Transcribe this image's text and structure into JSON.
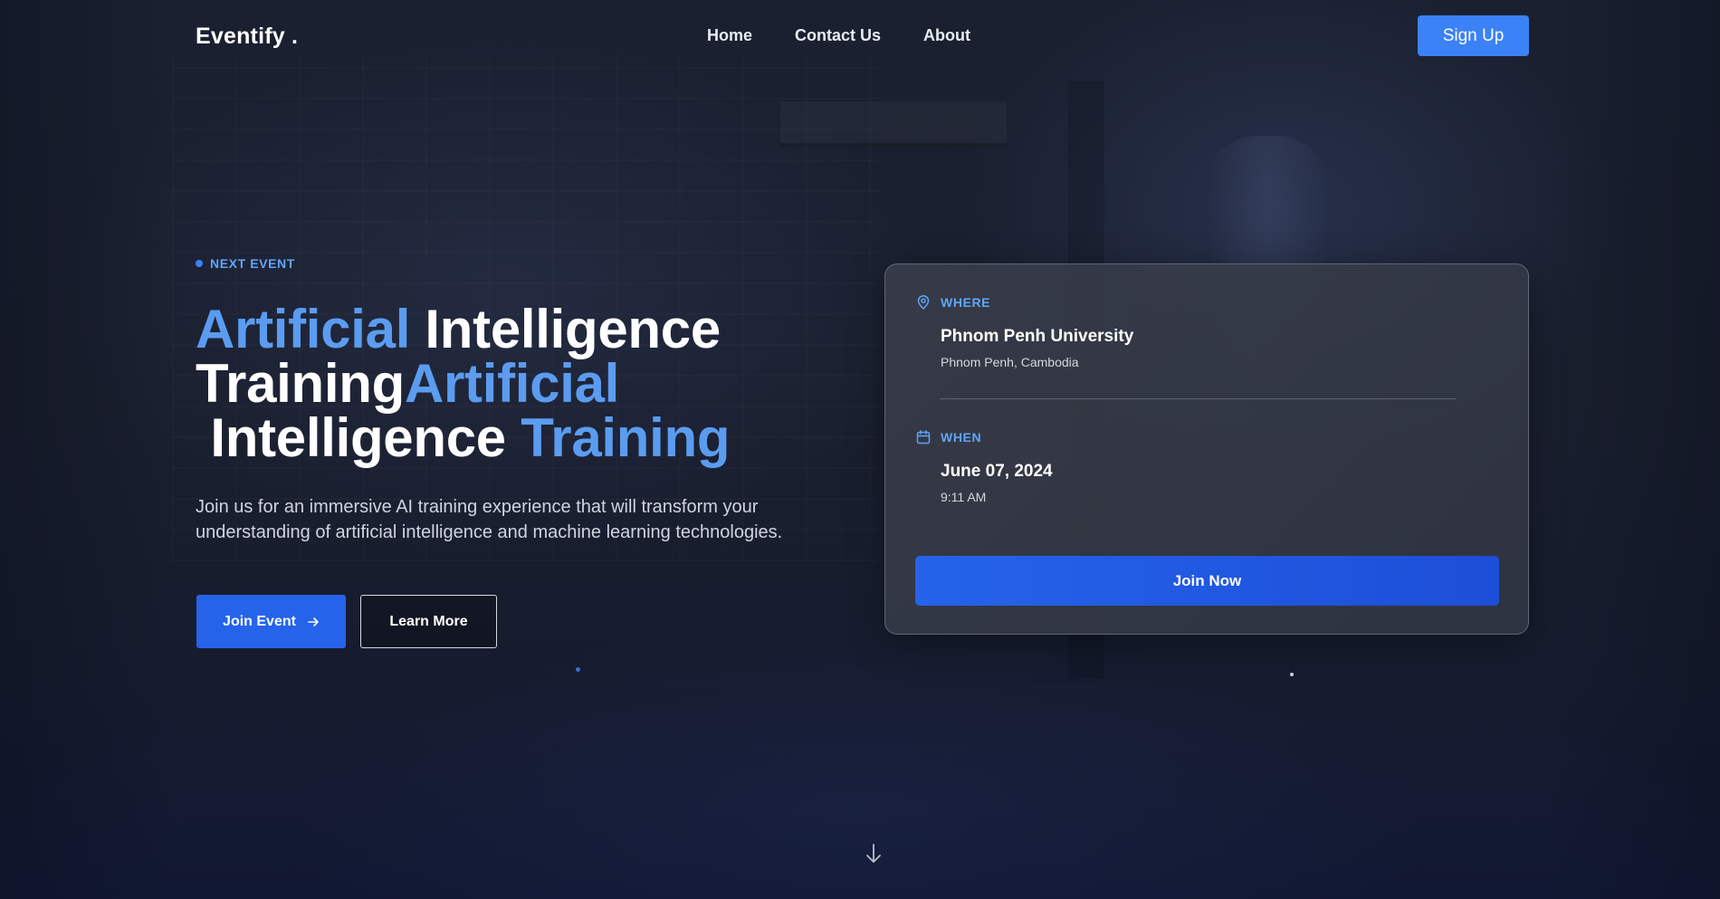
{
  "nav": {
    "logo": "Eventify .",
    "links": [
      "Home",
      "Contact Us",
      "About"
    ],
    "signup_label": "Sign Up"
  },
  "hero": {
    "eyebrow": "NEXT EVENT",
    "title_parts": [
      {
        "text": "Artificial",
        "highlight": true
      },
      {
        "text": " Intelligence Training",
        "highlight": false
      },
      {
        "text": "Artificial",
        "highlight": true
      },
      {
        "text": " Intelligence ",
        "highlight": false
      },
      {
        "text": "Training",
        "highlight": true
      }
    ],
    "description": "Join us for an immersive AI training experience that will transform your understanding of artificial intelligence and machine learning technologies.",
    "primary_label": "Join Event",
    "primary_icon": "arrow-right-icon",
    "secondary_label": "Learn More"
  },
  "card": {
    "where_label": "WHERE",
    "where_icon": "map-pin-icon",
    "venue": "Phnom Penh University",
    "location": "Phnom Penh, Cambodia",
    "when_label": "WHEN",
    "when_icon": "calendar-icon",
    "date": "June 07, 2024",
    "time": "9:11 AM",
    "join_label": "Join Now"
  },
  "scroll_icon": "arrow-down-icon",
  "colors": {
    "accent": "#3b82f6",
    "highlight_text": "#5b9cf0",
    "label_blue": "#60a5fa",
    "button_blue": "#2563eb",
    "background": "#1a1f2e"
  }
}
